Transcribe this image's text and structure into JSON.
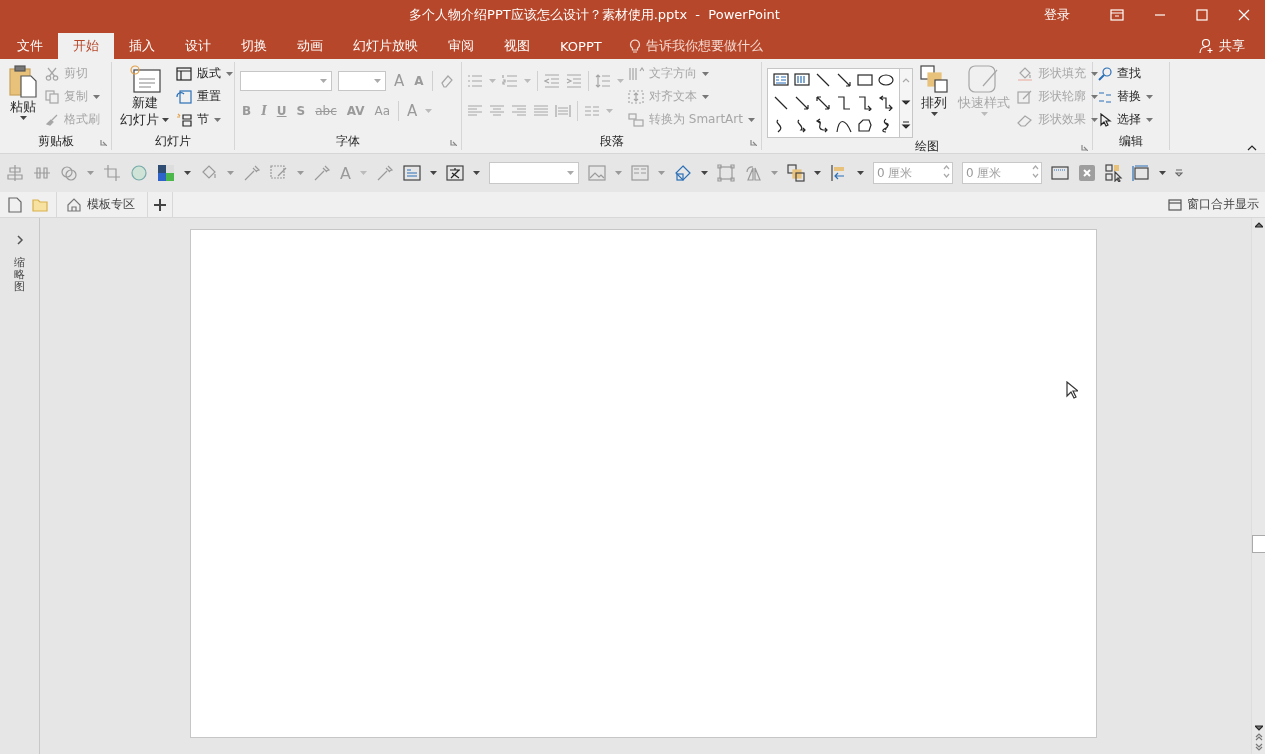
{
  "window": {
    "title": "多个人物介绍PPT应该怎么设计？素材使用.pptx  -  PowerPoint",
    "account": "登录"
  },
  "tabs": [
    {
      "label": "文件",
      "selected": false
    },
    {
      "label": "开始",
      "selected": true
    },
    {
      "label": "插入",
      "selected": false
    },
    {
      "label": "设计",
      "selected": false
    },
    {
      "label": "切换",
      "selected": false
    },
    {
      "label": "动画",
      "selected": false
    },
    {
      "label": "幻灯片放映",
      "selected": false
    },
    {
      "label": "审阅",
      "selected": false
    },
    {
      "label": "视图",
      "selected": false
    },
    {
      "label": "KOPPT",
      "selected": false
    }
  ],
  "tell_me": "告诉我你想要做什么",
  "share": "共享",
  "ribbon": {
    "clipboard": {
      "label": "剪贴板",
      "paste": "粘贴",
      "items": [
        {
          "label": "剪切",
          "disabled": true
        },
        {
          "label": "复制",
          "disabled": true
        },
        {
          "label": "格式刷",
          "disabled": true
        }
      ]
    },
    "slides": {
      "label": "幻灯片",
      "new_slide": "新建",
      "new_slide_2": "幻灯片",
      "items": [
        {
          "label": "版式",
          "disabled": false
        },
        {
          "label": "重置",
          "disabled": false
        },
        {
          "label": "节",
          "disabled": false
        }
      ]
    },
    "font": {
      "label": "字体",
      "size_buttons": [
        "A",
        "A"
      ],
      "format_buttons": [
        "B",
        "I",
        "U",
        "S",
        "abc",
        "AV",
        "Aa"
      ],
      "color_button": "A"
    },
    "paragraph": {
      "label": "段落",
      "items": [
        {
          "label": "文字方向",
          "disabled": true
        },
        {
          "label": "对齐文本",
          "disabled": true
        },
        {
          "label": "转换为 SmartArt",
          "disabled": true
        }
      ]
    },
    "drawing": {
      "label": "绘图",
      "arrange": "排列",
      "quick_styles": {
        "label": "快速样式",
        "disabled": true
      },
      "items": [
        {
          "label": "形状填充",
          "disabled": true
        },
        {
          "label": "形状轮廓",
          "disabled": true
        },
        {
          "label": "形状效果",
          "disabled": true
        }
      ]
    },
    "editing": {
      "label": "编辑",
      "items": [
        {
          "label": "查找",
          "disabled": false
        },
        {
          "label": "替换",
          "disabled": false
        },
        {
          "label": "选择",
          "disabled": false
        }
      ]
    }
  },
  "format_toolbar": {
    "text_button": "A",
    "spin_fields": [
      {
        "value": "0 厘米"
      },
      {
        "value": "0 厘米"
      }
    ]
  },
  "doc_tabs": {
    "tabs": [
      {
        "label": "模板专区"
      }
    ],
    "merge_windows": "窗口合并显示"
  },
  "thumbnail_panel": {
    "label": "缩略图"
  }
}
